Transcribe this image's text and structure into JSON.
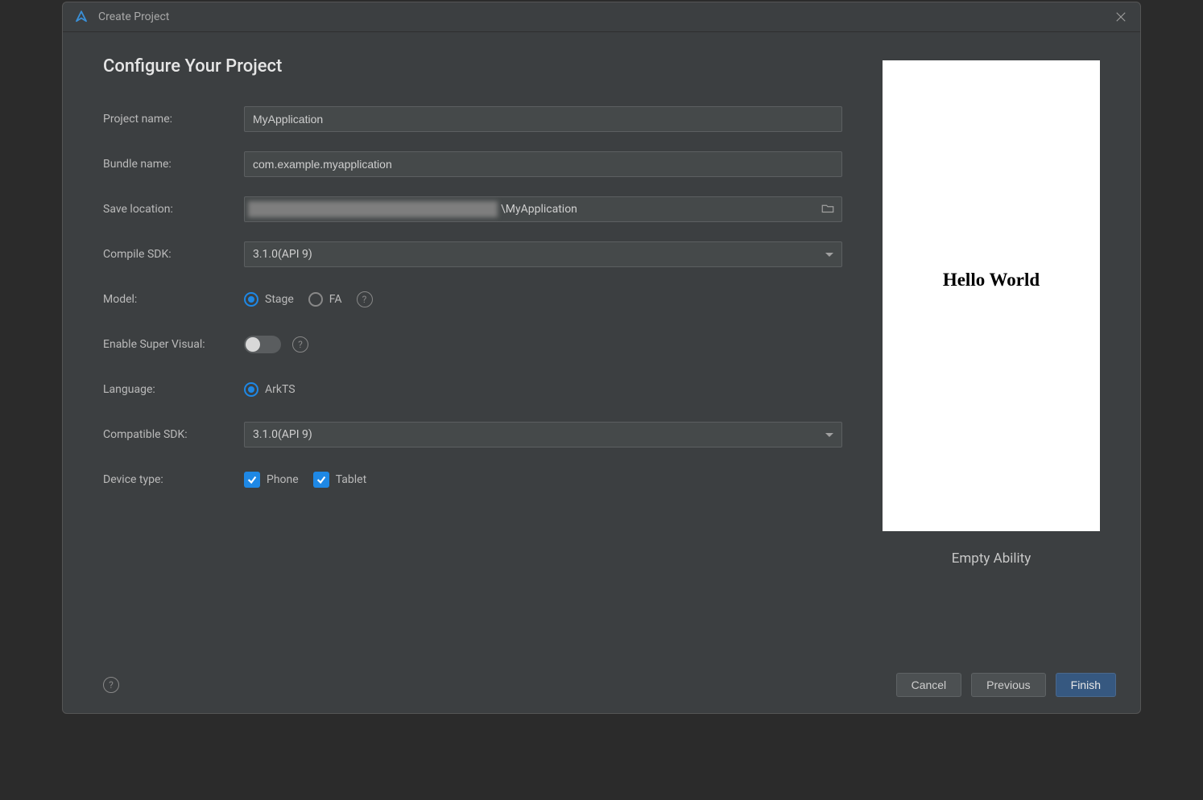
{
  "dialog": {
    "title": "Create Project",
    "heading": "Configure Your Project"
  },
  "form": {
    "project_name": {
      "label": "Project name:",
      "value": "MyApplication"
    },
    "bundle_name": {
      "label": "Bundle name:",
      "value": "com.example.myapplication"
    },
    "save_location": {
      "label": "Save location:",
      "suffix": "\\MyApplication"
    },
    "compile_sdk": {
      "label": "Compile SDK:",
      "value": "3.1.0(API 9)"
    },
    "model": {
      "label": "Model:",
      "options": [
        "Stage",
        "FA"
      ],
      "selected": "Stage"
    },
    "super_visual": {
      "label": "Enable Super Visual:",
      "enabled": false
    },
    "language": {
      "label": "Language:",
      "options": [
        "ArkTS"
      ],
      "selected": "ArkTS"
    },
    "compatible_sdk": {
      "label": "Compatible SDK:",
      "value": "3.1.0(API 9)"
    },
    "device_type": {
      "label": "Device type:",
      "options": [
        {
          "label": "Phone",
          "checked": true
        },
        {
          "label": "Tablet",
          "checked": true
        }
      ]
    }
  },
  "preview": {
    "content_text": "Hello World",
    "template_name": "Empty Ability"
  },
  "buttons": {
    "cancel": "Cancel",
    "previous": "Previous",
    "finish": "Finish"
  }
}
